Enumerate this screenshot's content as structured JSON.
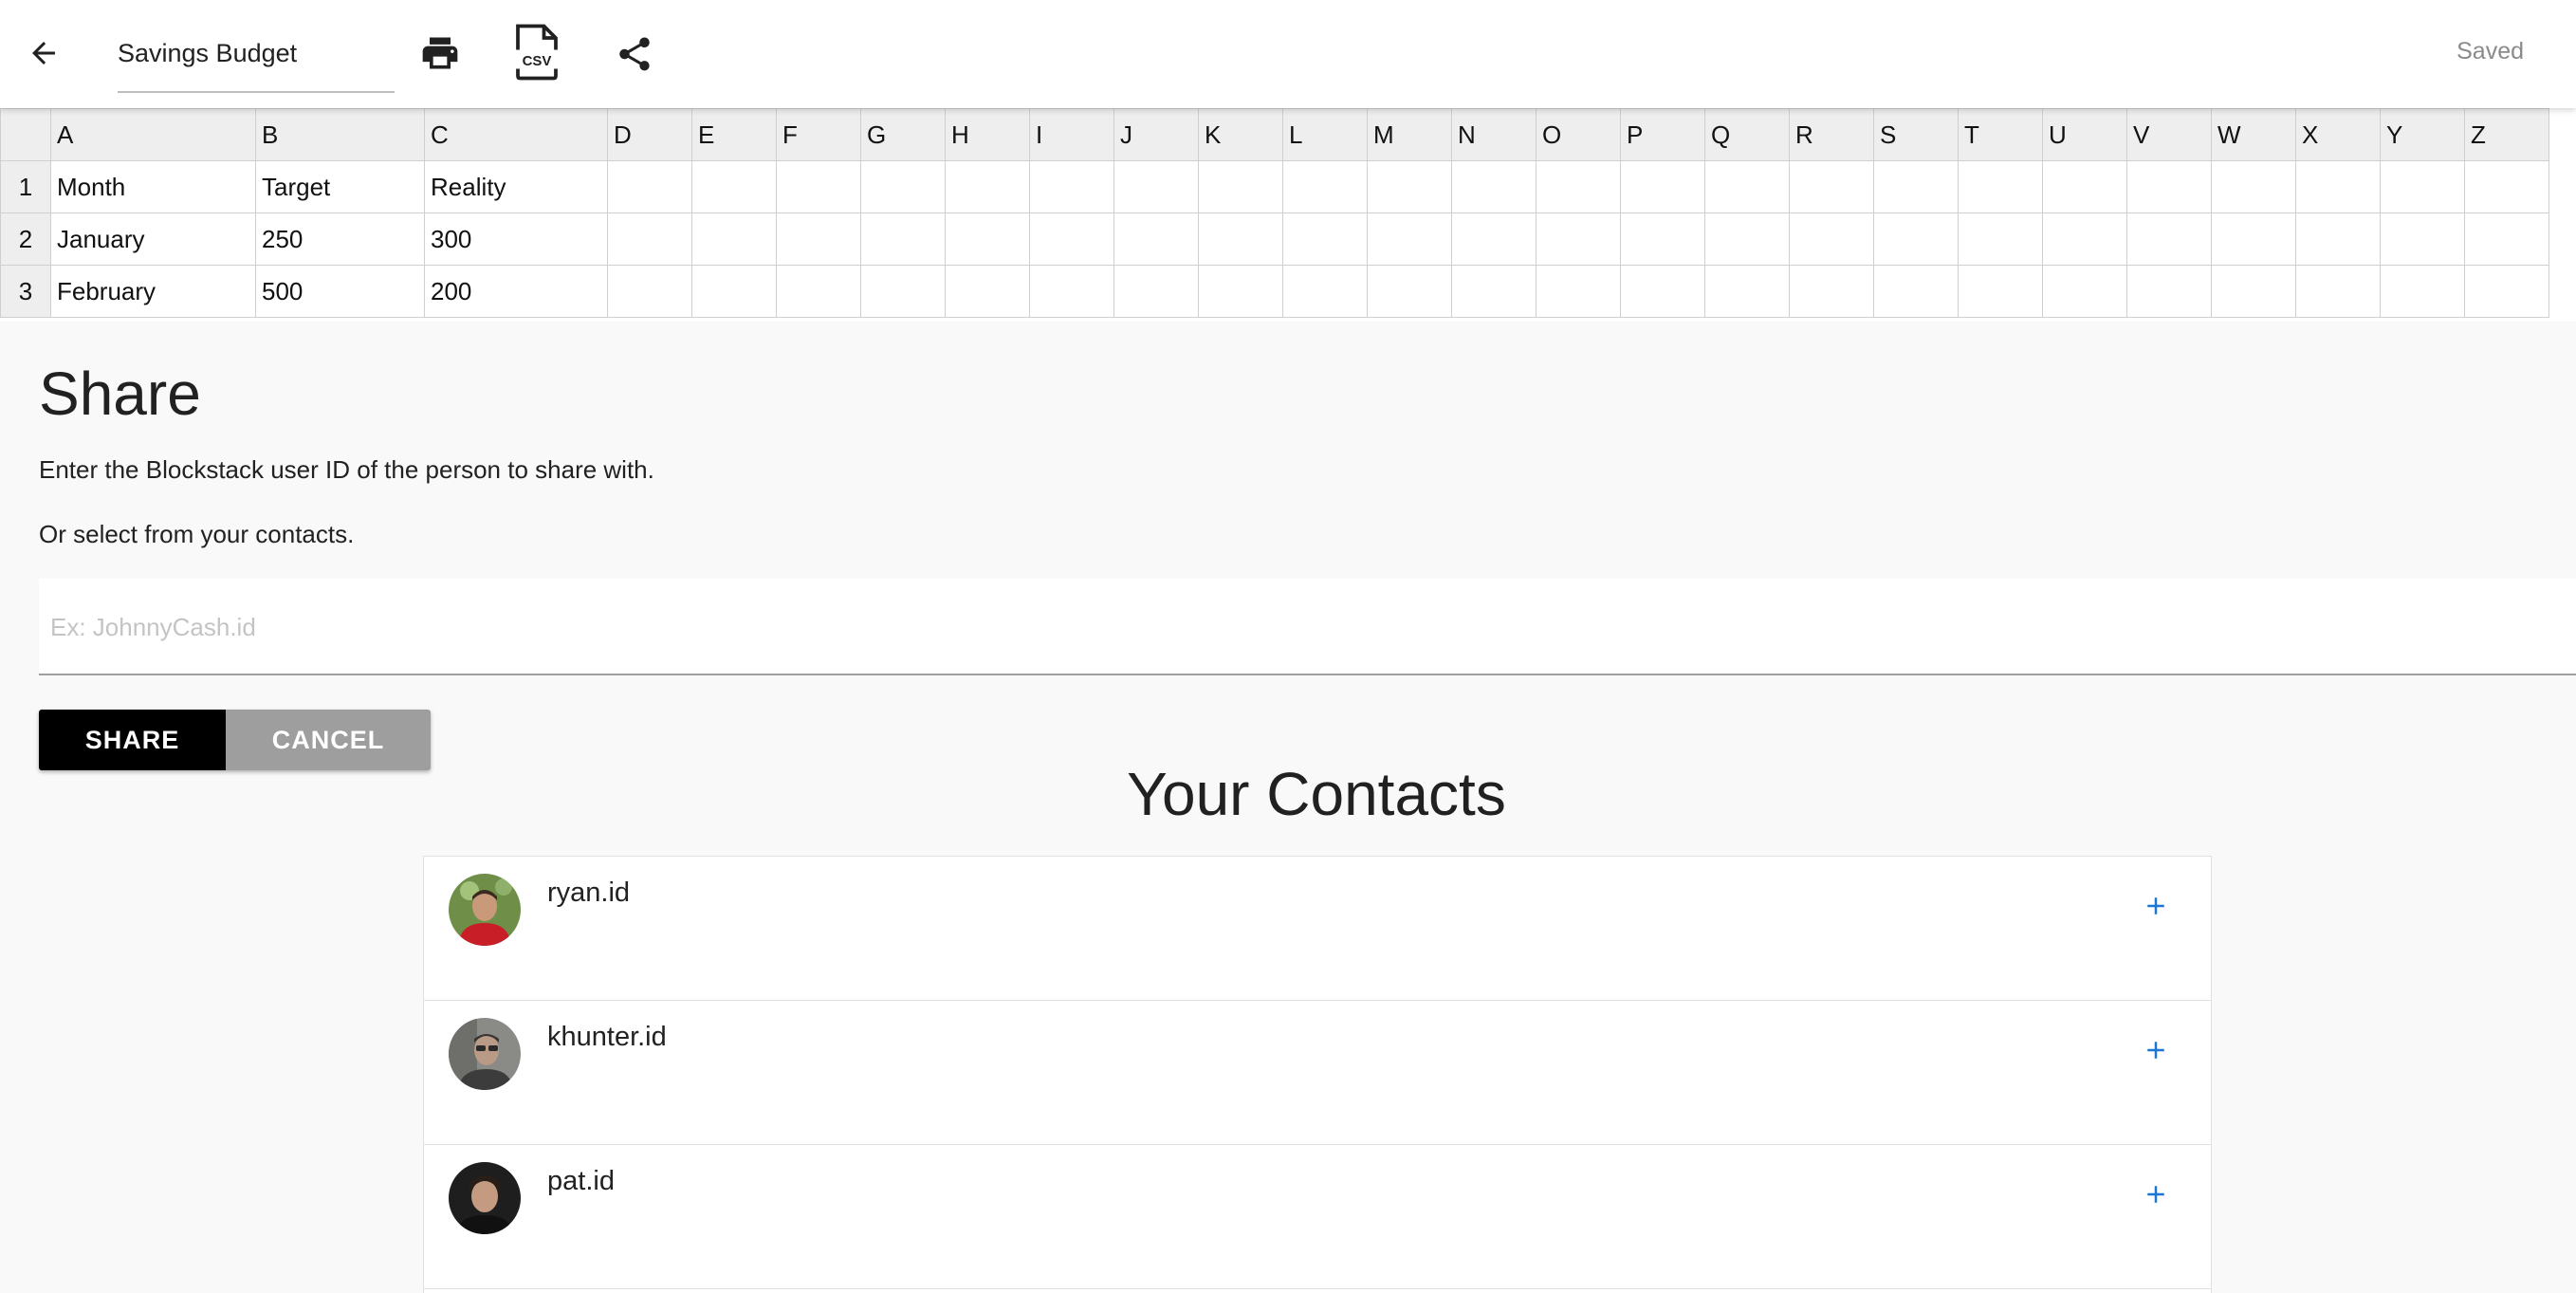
{
  "toolbar": {
    "back_icon": "arrow-left-icon",
    "title_value": "Savings Budget",
    "print_icon": "printer-icon",
    "csv_icon": "csv-file-icon",
    "csv_label": "CSV",
    "share_icon": "share-icon",
    "status": "Saved"
  },
  "sheet": {
    "columns": [
      "A",
      "B",
      "C",
      "D",
      "E",
      "F",
      "G",
      "H",
      "I",
      "J",
      "K",
      "L",
      "M",
      "N",
      "O",
      "P",
      "Q",
      "R",
      "S",
      "T",
      "U",
      "V",
      "W",
      "X",
      "Y",
      "Z"
    ],
    "rows": [
      {
        "num": "1",
        "cells": [
          "Month",
          "Target",
          "Reality"
        ]
      },
      {
        "num": "2",
        "cells": [
          "January",
          "250",
          "300"
        ]
      },
      {
        "num": "3",
        "cells": [
          "February",
          "500",
          "200"
        ]
      }
    ]
  },
  "share": {
    "title": "Share",
    "description": "Enter the Blockstack user ID of the person to share with.",
    "or_text": "Or select from your contacts.",
    "input_placeholder": "Ex: JohnnyCash.id",
    "input_value": "",
    "share_button": "SHARE",
    "cancel_button": "CANCEL"
  },
  "contacts": {
    "title": "Your Contacts",
    "add_icon": "plus-icon",
    "items": [
      {
        "name": "ryan.id",
        "avatar_color": "#5a7a3a",
        "shirt_color": "#c81e28"
      },
      {
        "name": "khunter.id",
        "avatar_color": "#6b6b6b",
        "shirt_color": "#3c3c3c"
      },
      {
        "name": "pat.id",
        "avatar_color": "#222222",
        "shirt_color": "#1a1a1a"
      }
    ]
  },
  "colors": {
    "accent": "#1976d2",
    "share_button_bg": "#000000",
    "cancel_button_bg": "#9e9e9e",
    "background": "#f9f9f9"
  }
}
